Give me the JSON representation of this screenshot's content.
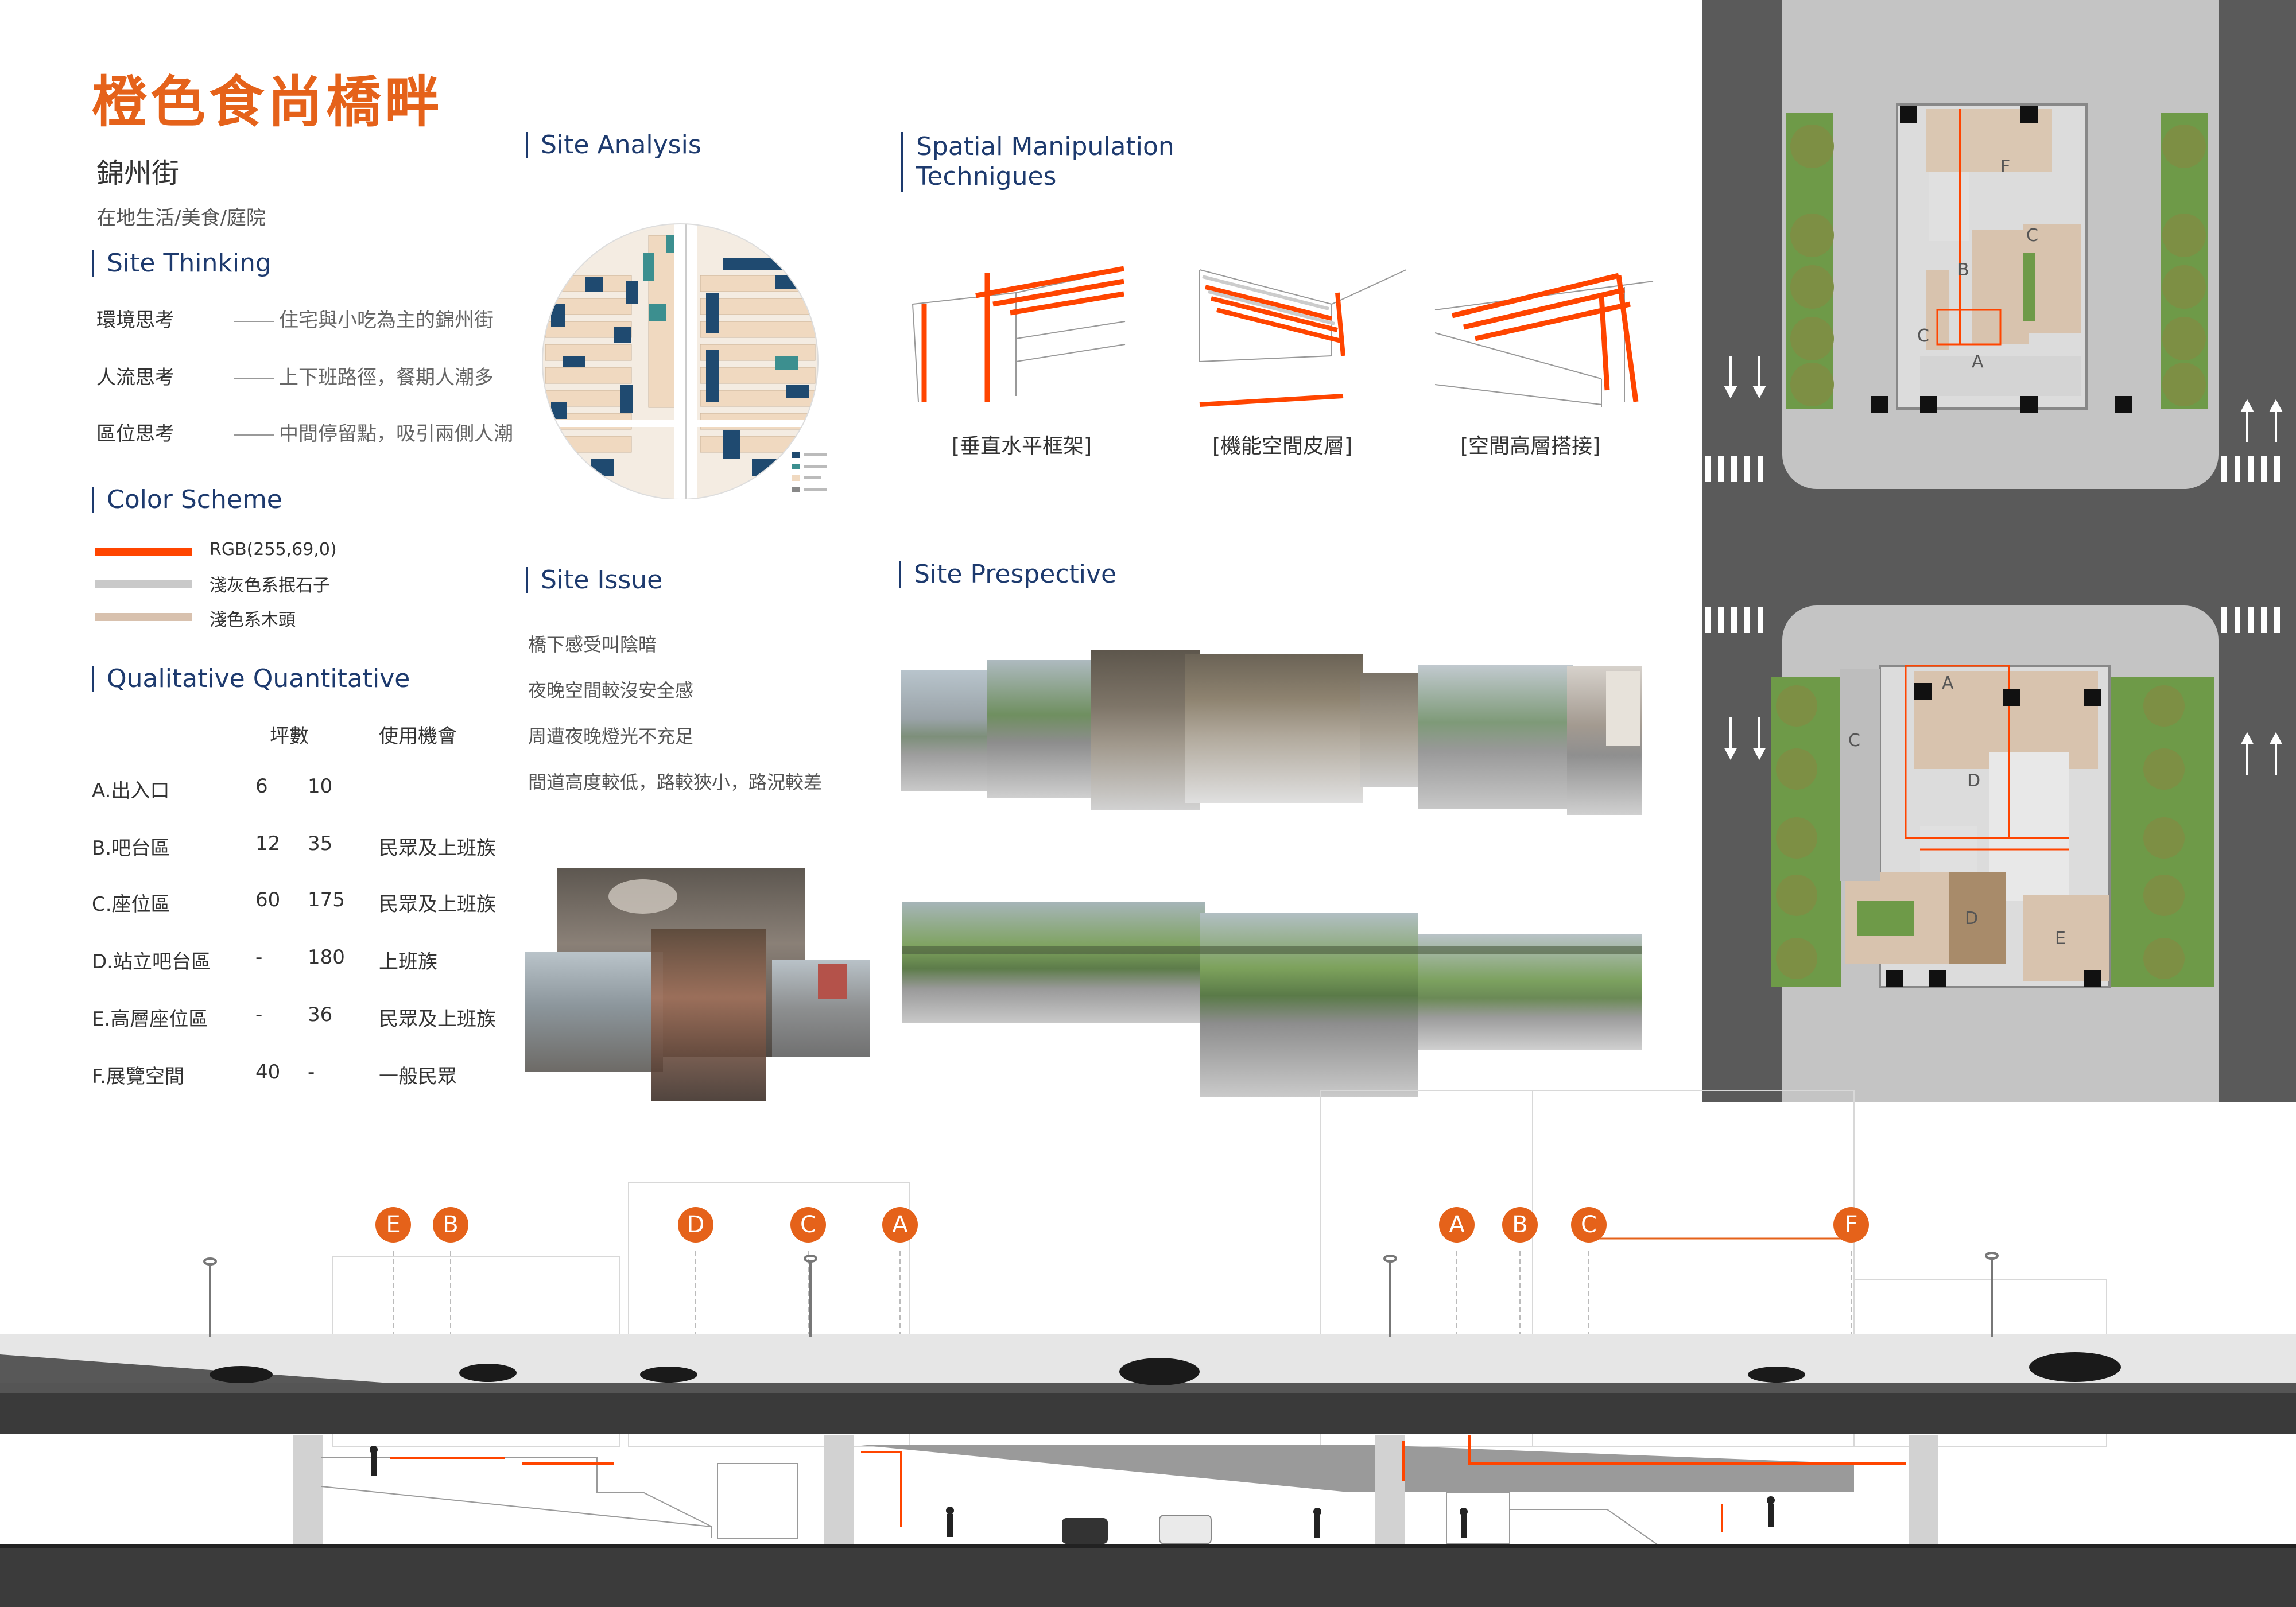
{
  "title": "橙色食尚橋畔",
  "street": "錦州街",
  "tags": "在地生活/美食/庭院",
  "colors": {
    "accent": "#e5621a",
    "navy": "#1d3a6e",
    "building": "#1f4a70",
    "road": "#5a5a5a",
    "grass": "#6e9a48"
  },
  "sections": {
    "site_thinking": "Site Thinking",
    "color_scheme": "Color Scheme",
    "qualitative": "Qualitative Quantitative",
    "site_analysis": "Site Analysis",
    "site_issue": "Site Issue",
    "spatial_line1": "Spatial Manipulation",
    "spatial_line2": "Technigues",
    "site_perspective": "Site Prespective"
  },
  "site_thinking": [
    {
      "key": "環境思考",
      "value": "住宅與小吃為主的錦州街"
    },
    {
      "key": "人流思考",
      "value": "上下班路徑，餐期人潮多"
    },
    {
      "key": "區位思考",
      "value": "中間停留點，吸引兩側人潮"
    }
  ],
  "color_scheme": [
    {
      "label": "RGB(255,69,0)",
      "color": "#ff4500"
    },
    {
      "label": "淺灰色系抿石子",
      "color": "#c9c9c9"
    },
    {
      "label": "淺色系木頭",
      "color": "#d8c1ae"
    }
  ],
  "table": {
    "headers": [
      "坪數",
      "使用機會"
    ],
    "rows": [
      {
        "name": "A.出入口",
        "a": "6",
        "b": "10",
        "use": ""
      },
      {
        "name": "B.吧台區",
        "a": "12",
        "b": "35",
        "use": "民眾及上班族"
      },
      {
        "name": "C.座位區",
        "a": "60",
        "b": "175",
        "use": "民眾及上班族"
      },
      {
        "name": "D.站立吧台區",
        "a": "-",
        "b": "180",
        "use": "上班族"
      },
      {
        "name": "E.高層座位區",
        "a": "-",
        "b": "36",
        "use": "民眾及上班族"
      },
      {
        "name": "F.展覽空間",
        "a": "40",
        "b": "-",
        "use": "一般民眾"
      }
    ]
  },
  "site_issue": [
    "橋下感受叫陰暗",
    "夜晚空間較沒安全感",
    "周遭夜晚燈光不充足",
    "間道高度較低，路較狹小，路況較差"
  ],
  "techniques": [
    "[垂直水平框架]",
    "[機能空間皮層]",
    "[空間高層搭接]"
  ],
  "section_markers": [
    "E",
    "B",
    "D",
    "C",
    "A",
    "A",
    "B",
    "C",
    "F"
  ],
  "plan_labels": {
    "top": [
      "F",
      "C",
      "B",
      "C",
      "A"
    ],
    "bottom": [
      "A",
      "C",
      "D",
      "D",
      "E"
    ]
  }
}
